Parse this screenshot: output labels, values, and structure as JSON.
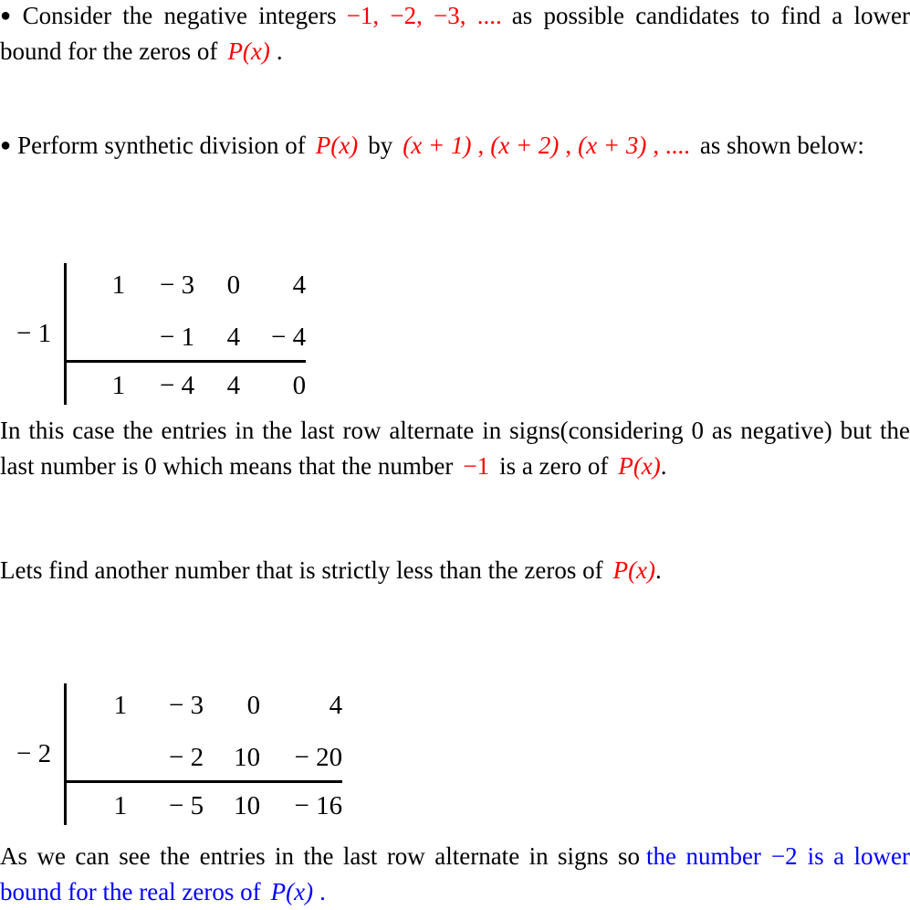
{
  "document": {
    "colors": {
      "accent_red": "#ff0000",
      "accent_blue": "#0000ff",
      "text": "#000000",
      "background": "#ffffff"
    }
  },
  "bullet_glyph": "●",
  "blocks": {
    "bullet1": {
      "bullet": "●",
      "text_before": "Consider the negative integers",
      "math_red": "−1, −2, −3, ....",
      "text_middle": "as possible candidates to find a lower bound for the zeros of",
      "math_red2": "P(x)",
      "text_after": "."
    },
    "bullet2": {
      "bullet": "●",
      "text_before": "Perform synthetic division of",
      "math_red": "P(x)",
      "text_middle": "by",
      "math_red2": "(x + 1)",
      "comma1": ",",
      "math_red3": "(x + 2)",
      "comma2": ",",
      "math_red4": "(x + 3)",
      "comma3": ", ....",
      "text_after": "as shown below:"
    },
    "paragraph1": {
      "part1": "In this case the entries in the last row alternate in signs(considering 0 as negative) but the last number is 0 which means that the number",
      "math_red": "−1",
      "part2": "is a zero of",
      "math_red2": "P(x)",
      "part3": "."
    },
    "paragraph2": {
      "part1": "Lets find another number that is strictly less than the zeros of",
      "math_red": "P(x)",
      "part2": "."
    },
    "paragraph3": {
      "part1": "As we can see the entries in the last row alternate in signs so",
      "blue_part1": "the number",
      "blue_math": "−2",
      "blue_part2": "is a lower bound for the real zeros of",
      "blue_math2": "P(x)",
      "blue_part3": "."
    }
  },
  "synthetic_division_1": {
    "divisor": "− 1",
    "dividend_row": [
      "1",
      "− 3",
      "0",
      "4"
    ],
    "multiply_row": [
      "",
      "− 1",
      "4",
      "− 4"
    ],
    "result_row": [
      "1",
      "− 4",
      "4",
      "0"
    ]
  },
  "synthetic_division_2": {
    "divisor": "− 2",
    "dividend_row": [
      "1",
      "− 3",
      "0",
      "4"
    ],
    "multiply_row": [
      "",
      "− 2",
      "10",
      "− 20"
    ],
    "result_row": [
      "1",
      "− 5",
      "10",
      "− 16"
    ]
  }
}
